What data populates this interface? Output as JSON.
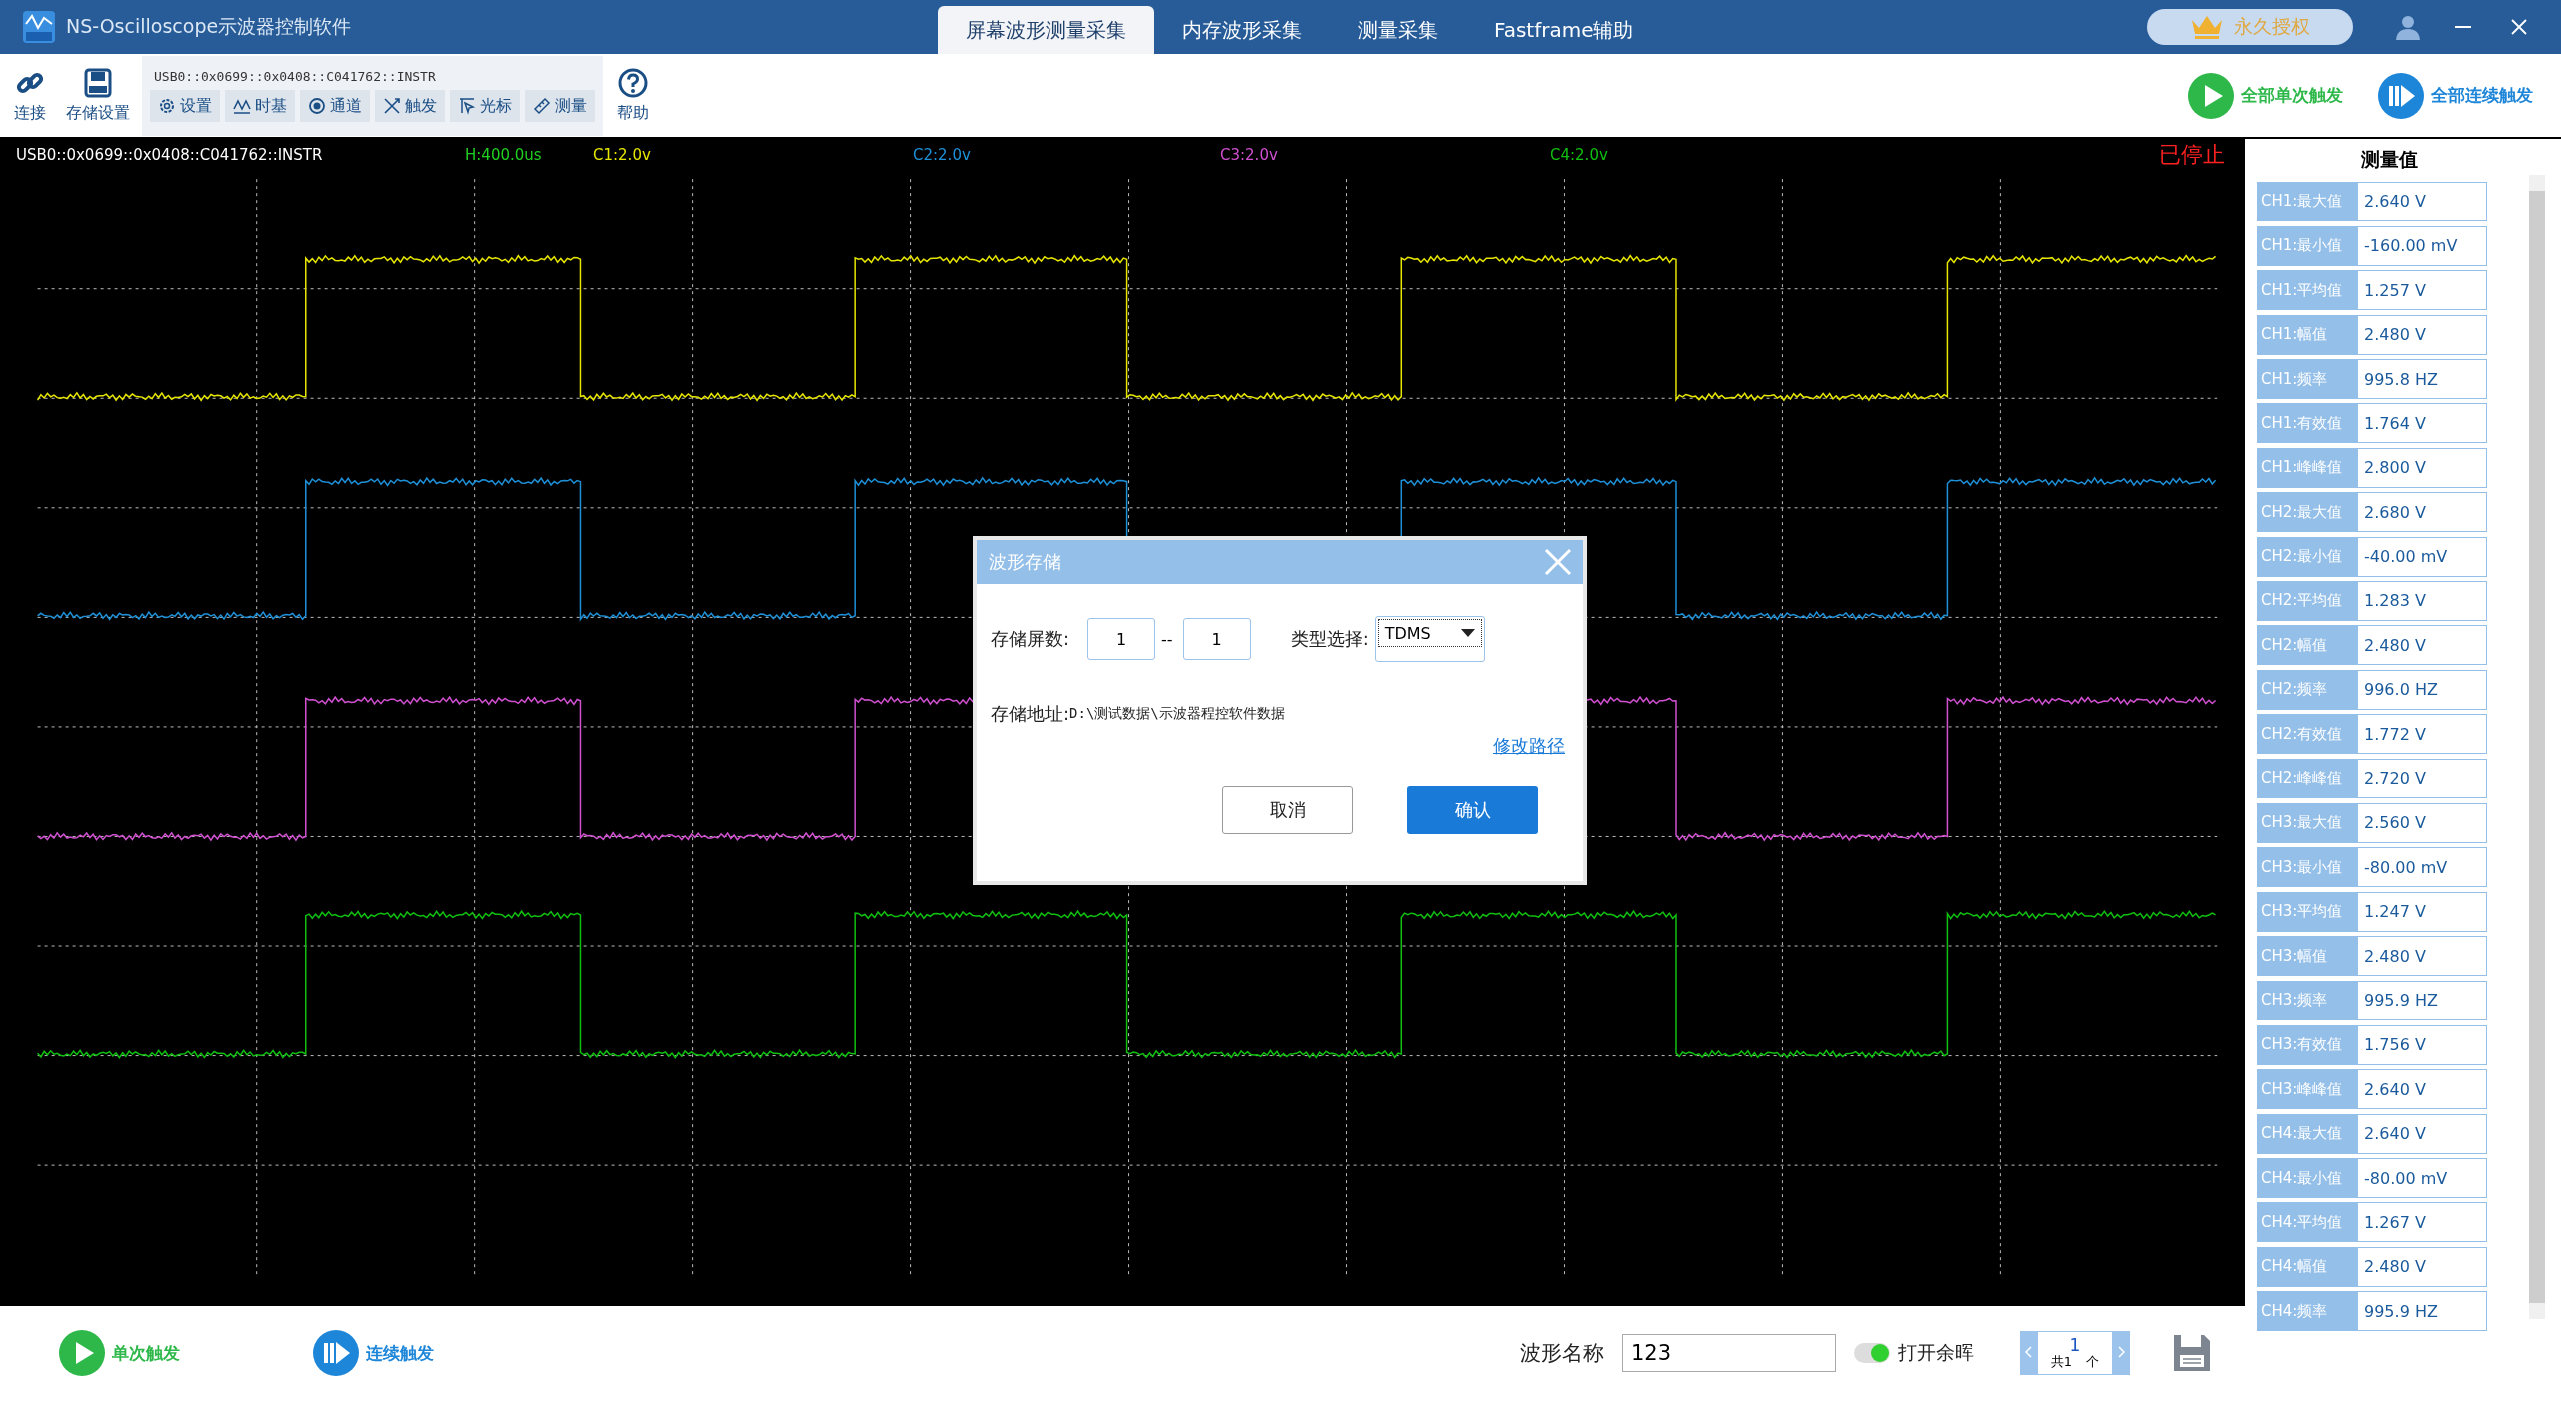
{
  "window": {
    "title": "NS-Oscilloscope示波器控制软件"
  },
  "tabs": [
    {
      "label": "屏幕波形测量采集",
      "selected": true
    },
    {
      "label": "内存波形采集",
      "selected": false
    },
    {
      "label": "测量采集",
      "selected": false
    },
    {
      "label": "Fastframe辅助",
      "selected": false
    }
  ],
  "license": {
    "label": "永久授权"
  },
  "toolbar": {
    "left": [
      {
        "label": "连接"
      },
      {
        "label": "存储设置"
      }
    ],
    "address": "USB0::0x0699::0x0408::C041762::INSTR",
    "buttons": [
      {
        "label": "设置"
      },
      {
        "label": "时基"
      },
      {
        "label": "通道"
      },
      {
        "label": "触发"
      },
      {
        "label": "光标"
      },
      {
        "label": "测量"
      }
    ],
    "help": {
      "label": "帮助"
    },
    "actions": [
      {
        "label": "全部单次触发",
        "kind": "single"
      },
      {
        "label": "全部连续触发",
        "kind": "continuous"
      }
    ]
  },
  "scope": {
    "address": "USB0::0x0699::0x0408::C041762::INSTR",
    "timebase": "H:400.0us",
    "channels": [
      {
        "label": "C1:2.0v",
        "color": "#e6e600"
      },
      {
        "label": "C2:2.0v",
        "color": "#1e90d8"
      },
      {
        "label": "C3:2.0v",
        "color": "#d050d0"
      },
      {
        "label": "C4:2.0v",
        "color": "#10c010"
      }
    ],
    "status": "已停止"
  },
  "dialog": {
    "title": "波形存储",
    "count_label": "存储屏数:",
    "from": "1",
    "separator": "--",
    "to": "1",
    "type_label": "类型选择:",
    "type_value": "TDMS",
    "path_label": "存储地址:",
    "path": "D:\\测试数据\\示波器程控软件数据",
    "change_link": "修改路径",
    "cancel": "取消",
    "confirm": "确认"
  },
  "measurements": {
    "title": "测量值",
    "rows": [
      {
        "label": "CH1:最大值",
        "value": "2.640 V"
      },
      {
        "label": "CH1:最小值",
        "value": "-160.00 mV"
      },
      {
        "label": "CH1:平均值",
        "value": "1.257 V"
      },
      {
        "label": "CH1:幅值",
        "value": "2.480 V"
      },
      {
        "label": "CH1:频率",
        "value": "995.8 HZ"
      },
      {
        "label": "CH1:有效值",
        "value": "1.764 V"
      },
      {
        "label": "CH1:峰峰值",
        "value": "2.800 V"
      },
      {
        "label": "CH2:最大值",
        "value": "2.680 V"
      },
      {
        "label": "CH2:最小值",
        "value": "-40.00 mV"
      },
      {
        "label": "CH2:平均值",
        "value": "1.283 V"
      },
      {
        "label": "CH2:幅值",
        "value": "2.480 V"
      },
      {
        "label": "CH2:频率",
        "value": "996.0 HZ"
      },
      {
        "label": "CH2:有效值",
        "value": "1.772 V"
      },
      {
        "label": "CH2:峰峰值",
        "value": "2.720 V"
      },
      {
        "label": "CH3:最大值",
        "value": "2.560 V"
      },
      {
        "label": "CH3:最小值",
        "value": "-80.00 mV"
      },
      {
        "label": "CH3:平均值",
        "value": "1.247 V"
      },
      {
        "label": "CH3:幅值",
        "value": "2.480 V"
      },
      {
        "label": "CH3:频率",
        "value": "995.9 HZ"
      },
      {
        "label": "CH3:有效值",
        "value": "1.756 V"
      },
      {
        "label": "CH3:峰峰值",
        "value": "2.640 V"
      },
      {
        "label": "CH4:最大值",
        "value": "2.640 V"
      },
      {
        "label": "CH4:最小值",
        "value": "-80.00 mV"
      },
      {
        "label": "CH4:平均值",
        "value": "1.267 V"
      },
      {
        "label": "CH4:幅值",
        "value": "2.480 V"
      },
      {
        "label": "CH4:频率",
        "value": "995.9 HZ"
      }
    ]
  },
  "bottom": {
    "actions": [
      {
        "label": "单次触发",
        "kind": "single"
      },
      {
        "label": "连续触发",
        "kind": "continuous"
      }
    ],
    "name_label": "波形名称",
    "name_value": "123",
    "afterglow": {
      "label": "打开余晖",
      "on": true
    },
    "pager": {
      "page": "1",
      "total": "共1",
      "unit": "个"
    }
  }
}
